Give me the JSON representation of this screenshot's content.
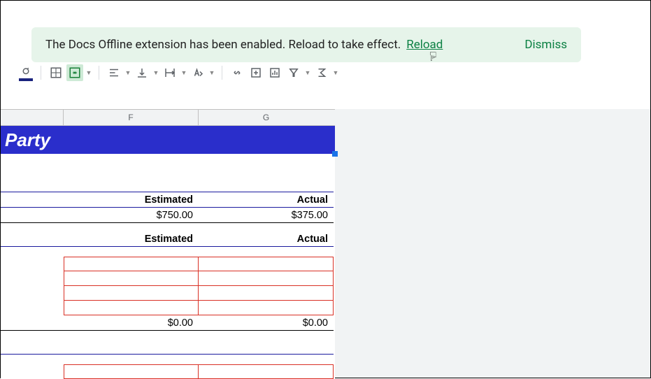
{
  "toast": {
    "message": "The Docs Offline extension has been enabled. Reload to take effect.",
    "reload_label": "Reload",
    "dismiss_label": "Dismiss"
  },
  "columns": {
    "F": "F",
    "G": "G"
  },
  "sheet": {
    "title": "Party",
    "headers1": {
      "estimated": "Estimated",
      "actual": "Actual"
    },
    "values1": {
      "estimated": "$750.00",
      "actual": "$375.00"
    },
    "headers2": {
      "estimated": "Estimated",
      "actual": "Actual"
    },
    "totals2": {
      "estimated": "$0.00",
      "actual": "$0.00"
    }
  }
}
